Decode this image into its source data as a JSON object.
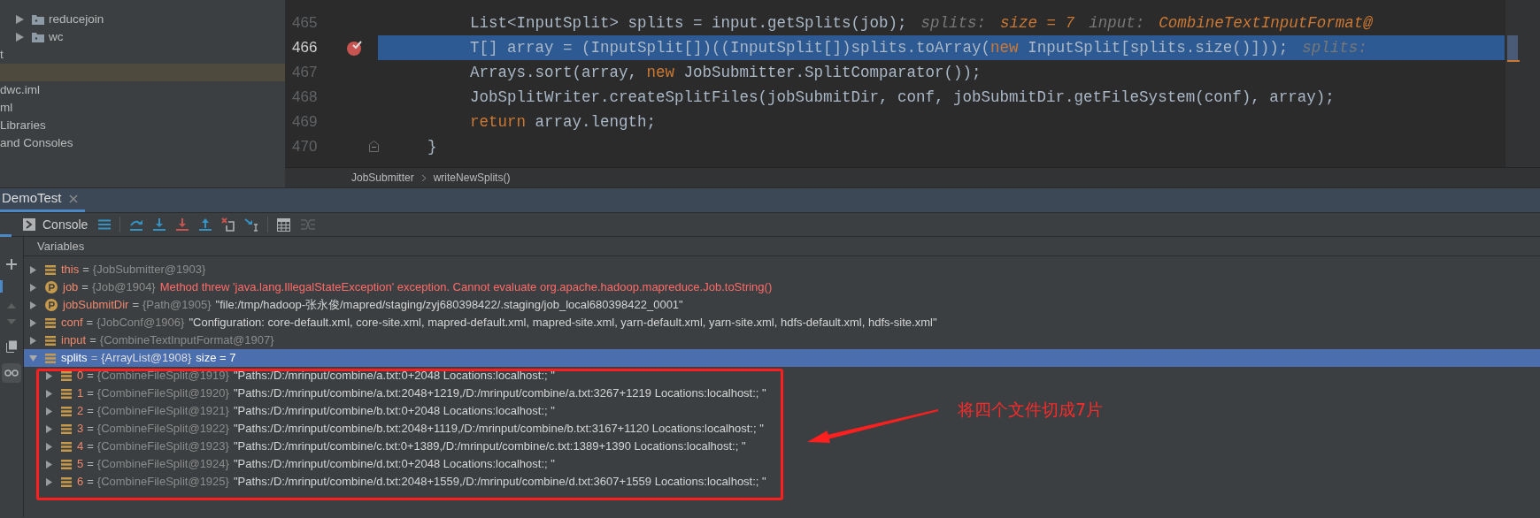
{
  "project_tree": [
    {
      "label": "reducejoin",
      "kind": "folder",
      "selected": false
    },
    {
      "label": "wc",
      "kind": "folder",
      "selected": false
    },
    {
      "label": "t",
      "kind": "text",
      "selected": false
    },
    {
      "kind": "text",
      "selected": true
    },
    {
      "label": "dwc.iml",
      "kind": "text",
      "selected": false
    },
    {
      "label": "ml",
      "kind": "text",
      "selected": false
    },
    {
      "label": "Libraries",
      "kind": "text",
      "selected": false
    },
    {
      "label": "and Consoles",
      "kind": "text",
      "selected": false
    }
  ],
  "editor": {
    "lines": [
      {
        "number": "465",
        "indented": true,
        "highlighted": false,
        "breakpoint": false,
        "fold": false,
        "tokens": [
          {
            "kind": "plain",
            "text": "List<InputSplit> splits = input.getSplits(job);"
          },
          {
            "kind": "hint_name",
            "text": "splits:"
          },
          {
            "kind": "hint_value",
            "text": "size = 7"
          },
          {
            "kind": "hint_name",
            "text": "input:"
          },
          {
            "kind": "hint_value",
            "text": "CombineTextInputFormat@"
          }
        ]
      },
      {
        "number": "466",
        "indented": true,
        "highlighted": true,
        "breakpoint": true,
        "fold": false,
        "tokens": [
          {
            "kind": "plain",
            "text": "T[] array = (InputSplit[])((InputSplit[])splits.toArray("
          },
          {
            "kind": "keyword",
            "text": "new"
          },
          {
            "kind": "plain",
            "text": " InputSplit[splits.size()]));"
          },
          {
            "kind": "hint_name",
            "text": "splits:"
          }
        ]
      },
      {
        "number": "467",
        "indented": true,
        "highlighted": false,
        "breakpoint": false,
        "fold": false,
        "tokens": [
          {
            "kind": "plain",
            "text": "Arrays.sort(array, "
          },
          {
            "kind": "keyword",
            "text": "new"
          },
          {
            "kind": "plain",
            "text": " JobSubmitter.SplitComparator());"
          }
        ]
      },
      {
        "number": "468",
        "indented": true,
        "highlighted": false,
        "breakpoint": false,
        "fold": false,
        "tokens": [
          {
            "kind": "plain",
            "text": "JobSplitWriter.createSplitFiles(jobSubmitDir, conf, jobSubmitDir.getFileSystem(conf), array);"
          }
        ]
      },
      {
        "number": "469",
        "indented": true,
        "highlighted": false,
        "breakpoint": false,
        "fold": false,
        "tokens": [
          {
            "kind": "keyword",
            "text": "return"
          },
          {
            "kind": "plain",
            "text": " array.length;"
          }
        ]
      },
      {
        "number": "470",
        "indented": false,
        "highlighted": false,
        "breakpoint": false,
        "fold": true,
        "tokens": [
          {
            "kind": "plain",
            "text": "}"
          }
        ]
      }
    ],
    "breadcrumbs": [
      "JobSubmitter",
      "writeNewSplits()"
    ]
  },
  "debug": {
    "tab": "DemoTest",
    "console": "Console",
    "variables_title": "Variables",
    "variables": [
      {
        "kind": "field",
        "name": "this",
        "eq": "=",
        "type": "{JobSubmitter@1903}",
        "expanded": false,
        "selected": false
      },
      {
        "kind": "parameter",
        "name": "job",
        "eq": "=",
        "type": "{Job@1904}",
        "value": "Method threw 'java.lang.IllegalStateException' exception. Cannot evaluate org.apache.hadoop.mapreduce.Job.toString()",
        "error": true,
        "expanded": false,
        "selected": false
      },
      {
        "kind": "parameter",
        "name": "jobSubmitDir",
        "eq": "=",
        "type": "{Path@1905}",
        "value": "\"file:/tmp/hadoop-张永俊/mapred/staging/zyj680398422/.staging/job_local680398422_0001\"",
        "error": false,
        "expanded": false,
        "selected": false
      },
      {
        "kind": "field",
        "name": "conf",
        "eq": "=",
        "type": "{JobConf@1906}",
        "value": "\"Configuration: core-default.xml, core-site.xml, mapred-default.xml, mapred-site.xml, yarn-default.xml, yarn-site.xml, hdfs-default.xml, hdfs-site.xml\"",
        "error": false,
        "expanded": false,
        "selected": false
      },
      {
        "kind": "field",
        "name": "input",
        "eq": "=",
        "type": "{CombineTextInputFormat@1907}",
        "expanded": false,
        "selected": false
      },
      {
        "kind": "field",
        "name": "splits",
        "eq": "=",
        "type": "{ArrayList@1908}",
        "value": "size = 7",
        "error": false,
        "expanded": true,
        "selected": true,
        "children": [
          {
            "kind": "field",
            "name": "0",
            "eq": "=",
            "type": "{CombineFileSplit@1919}",
            "value": "\"Paths:/D:/mrinput/combine/a.txt:0+2048 Locations:localhost:; \"",
            "error": false,
            "expanded": false,
            "selected": false
          },
          {
            "kind": "field",
            "name": "1",
            "eq": "=",
            "type": "{CombineFileSplit@1920}",
            "value": "\"Paths:/D:/mrinput/combine/a.txt:2048+1219,/D:/mrinput/combine/a.txt:3267+1219 Locations:localhost:; \"",
            "error": false,
            "expanded": false,
            "selected": false
          },
          {
            "kind": "field",
            "name": "2",
            "eq": "=",
            "type": "{CombineFileSplit@1921}",
            "value": "\"Paths:/D:/mrinput/combine/b.txt:0+2048 Locations:localhost:; \"",
            "error": false,
            "expanded": false,
            "selected": false
          },
          {
            "kind": "field",
            "name": "3",
            "eq": "=",
            "type": "{CombineFileSplit@1922}",
            "value": "\"Paths:/D:/mrinput/combine/b.txt:2048+1119,/D:/mrinput/combine/b.txt:3167+1120 Locations:localhost:; \"",
            "error": false,
            "expanded": false,
            "selected": false
          },
          {
            "kind": "field",
            "name": "4",
            "eq": "=",
            "type": "{CombineFileSplit@1923}",
            "value": "\"Paths:/D:/mrinput/combine/c.txt:0+1389,/D:/mrinput/combine/c.txt:1389+1390 Locations:localhost:; \"",
            "error": false,
            "expanded": false,
            "selected": false
          },
          {
            "kind": "field",
            "name": "5",
            "eq": "=",
            "type": "{CombineFileSplit@1924}",
            "value": "\"Paths:/D:/mrinput/combine/d.txt:0+2048 Locations:localhost:; \"",
            "error": false,
            "expanded": false,
            "selected": false
          },
          {
            "kind": "field",
            "name": "6",
            "eq": "=",
            "type": "{CombineFileSplit@1925}",
            "value": "\"Paths:/D:/mrinput/combine/d.txt:2048+1559,/D:/mrinput/combine/d.txt:3607+1559 Locations:localhost:; \"",
            "error": false,
            "expanded": false,
            "selected": false
          }
        ]
      }
    ]
  },
  "annotation": {
    "text": "将四个文件切成7片"
  }
}
